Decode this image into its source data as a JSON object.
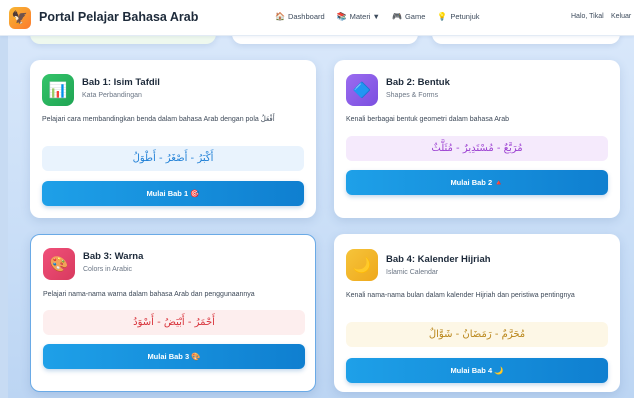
{
  "header": {
    "title": "Portal Pelajar Bahasa Arab",
    "nav": [
      {
        "icon": "🏠",
        "label": "Dashboard"
      },
      {
        "icon": "📚",
        "label": "Materi ▼"
      },
      {
        "icon": "🎮",
        "label": "Game"
      },
      {
        "icon": "💡",
        "label": "Petunjuk"
      }
    ],
    "greeting": "Halo, Tikal",
    "logout": "Keluar"
  },
  "cards": [
    {
      "title": "Bab 1: Isim Tafdil",
      "subtitle": "Kata Perbandingan",
      "description": "Pelajari cara membandingkan benda dalam bahasa Arab dengan pola أَفْعَلُ",
      "arabic": "أَكْبَرُ - أَصْغَرُ - أَطْوَلُ",
      "button": "Mulai Bab 1 🎯",
      "icon": "📊",
      "arabic_color": "#1e7fd6",
      "arabic_bg": "#e9f3fd"
    },
    {
      "title": "Bab 2: Bentuk",
      "subtitle": "Shapes & Forms",
      "description": "Kenali berbagai bentuk geometri dalam bahasa Arab",
      "arabic": "مُرَبَّعٌ - مُسْتَدِيرٌ - مُثَلَّثٌ",
      "button": "Mulai Bab 2 🔺",
      "icon": "🔷",
      "arabic_color": "#9b3fd1",
      "arabic_bg": "#f5eafc"
    },
    {
      "title": "Bab 3: Warna",
      "subtitle": "Colors in Arabic",
      "description": "Pelajari nama-nama warna dalam bahasa Arab dan penggunaannya",
      "arabic": "أَحْمَرُ - أَبْيَضُ - أَسْوَدُ",
      "button": "Mulai Bab 3 🎨",
      "icon": "🎨",
      "arabic_color": "#d8333b",
      "arabic_bg": "#fdeeee"
    },
    {
      "title": "Bab 4: Kalender Hijriah",
      "subtitle": "Islamic Calendar",
      "description": "Kenali nama-nama bulan dalam kalender Hijriah dan peristiwa pentingnya",
      "arabic": "مُحَرَّمٌ - رَمَضَانُ - شَوَّالٌ",
      "button": "Mulai Bab 4 🌙",
      "icon": "🌙",
      "arabic_color": "#b9861a",
      "arabic_bg": "#fdf7e6"
    }
  ]
}
